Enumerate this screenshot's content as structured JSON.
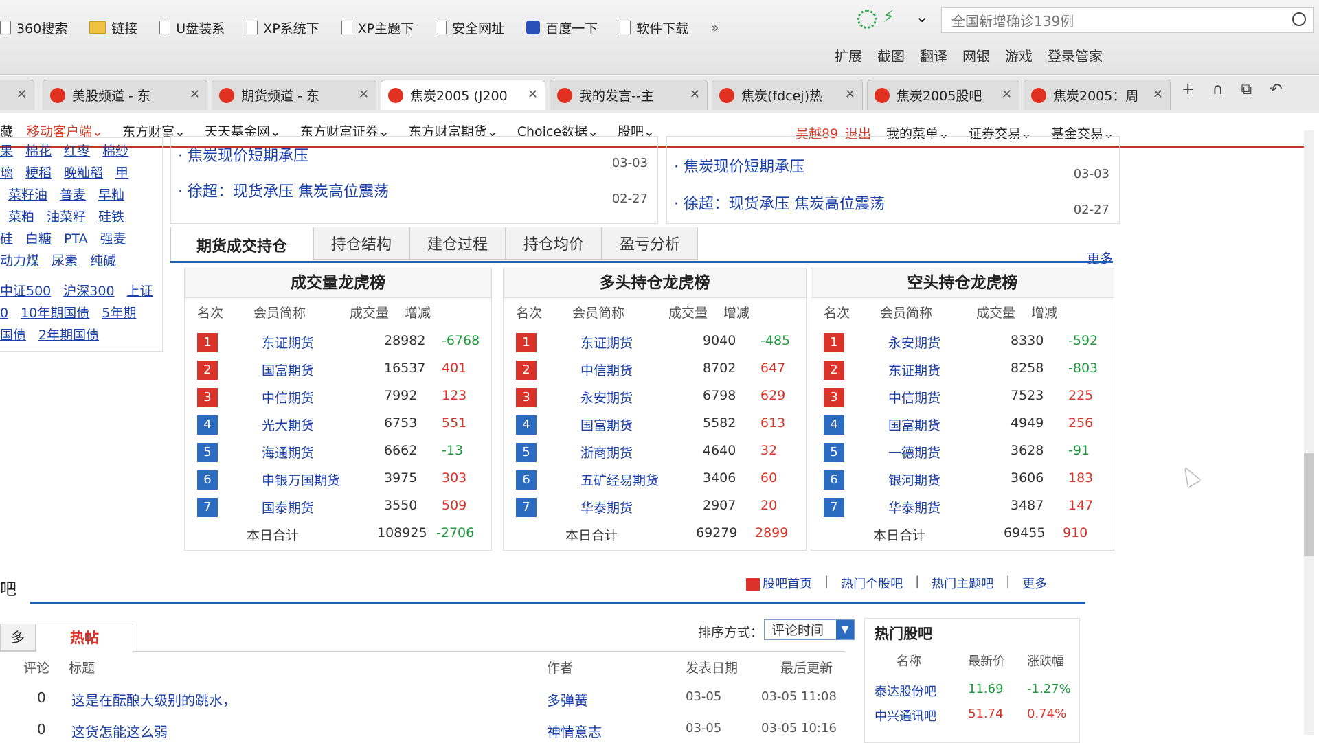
{
  "bookmarks": [
    {
      "label": "360搜索",
      "icon": "page-icon"
    },
    {
      "label": "链接",
      "icon": "folder-icon"
    },
    {
      "label": "U盘装系",
      "icon": "page-icon"
    },
    {
      "label": "XP系统下",
      "icon": "page-icon"
    },
    {
      "label": "XP主题下",
      "icon": "page-icon"
    },
    {
      "label": "安全网址",
      "icon": "page-icon"
    },
    {
      "label": "百度一下",
      "icon": "baidu-paw-icon"
    },
    {
      "label": "软件下载",
      "icon": "page-icon"
    }
  ],
  "bookmark_more": "»",
  "search": {
    "text": "全国新增确诊139例"
  },
  "tools": [
    "扩展",
    "截图",
    "翻译",
    "网银",
    "游戏",
    "登录管家"
  ],
  "tabs": [
    {
      "label": "美股频道 - 东",
      "active": false
    },
    {
      "label": "期货频道 - 东",
      "active": false
    },
    {
      "label": "焦炭2005 (J200",
      "active": true
    },
    {
      "label": "我的发言--主",
      "active": false
    },
    {
      "label": "焦炭(fdcej)热",
      "active": false
    },
    {
      "label": "焦炭2005股吧",
      "active": false
    },
    {
      "label": "焦炭2005：周",
      "active": false
    }
  ],
  "tab_controls": [
    "+",
    "∩",
    "⧉",
    "↶"
  ],
  "nav": {
    "first": "藏",
    "items": [
      "移动客户端",
      "东方财富",
      "天天基金网",
      "东方财富证券",
      "东方财富期货",
      "Choice数据",
      "股吧"
    ],
    "user": "吴越89",
    "logout": "退出",
    "right": [
      "我的菜单",
      "证券交易",
      "基金交易"
    ]
  },
  "sidebar": [
    [
      "果",
      "棉花",
      "红枣",
      "棉纱"
    ],
    [
      "璃",
      "粳稻",
      "晚籼稻",
      "甲"
    ],
    [
      "",
      "菜籽油",
      "普麦",
      "早籼"
    ],
    [
      "",
      "菜粕",
      "油菜籽",
      "硅铁"
    ],
    [
      "硅",
      "白糖",
      "PTA",
      "强麦"
    ],
    [
      "动力煤",
      "尿素",
      "纯碱"
    ],
    [],
    [
      "中证500",
      "沪深300",
      "上证"
    ],
    [
      "0",
      "10年期国债",
      "5年期"
    ],
    [
      "国债",
      "2年期国债"
    ]
  ],
  "news_left": [
    {
      "title": "焦炭现价短期承压",
      "date": "03-03"
    },
    {
      "title": "徐超：现货承压 焦炭高位震荡",
      "date": "02-27"
    }
  ],
  "news_right": [
    {
      "title": "焦炭现价短期承压",
      "date": "03-03"
    },
    {
      "title": "徐超：现货承压 焦炭高位震荡",
      "date": "02-27"
    }
  ],
  "main_tabs": [
    "期货成交持仓",
    "持仓结构",
    "建仓过程",
    "持仓均价",
    "盈亏分析"
  ],
  "more": "更多",
  "panels": [
    {
      "title": "成交量龙虎榜",
      "headers": [
        "名次",
        "会员简称",
        "成交量",
        "增减"
      ],
      "rows": [
        {
          "rank": "1",
          "name": "东证期货",
          "vol": "28982",
          "chg": "-6768"
        },
        {
          "rank": "2",
          "name": "国富期货",
          "vol": "16537",
          "chg": "401"
        },
        {
          "rank": "3",
          "name": "中信期货",
          "vol": "7992",
          "chg": "123"
        },
        {
          "rank": "4",
          "name": "光大期货",
          "vol": "6753",
          "chg": "551"
        },
        {
          "rank": "5",
          "name": "海通期货",
          "vol": "6662",
          "chg": "-13"
        },
        {
          "rank": "6",
          "name": "申银万国期货",
          "vol": "3975",
          "chg": "303"
        },
        {
          "rank": "7",
          "name": "国泰期货",
          "vol": "3550",
          "chg": "509"
        }
      ],
      "total": {
        "label": "本日合计",
        "vol": "108925",
        "chg": "-2706"
      }
    },
    {
      "title": "多头持仓龙虎榜",
      "headers": [
        "名次",
        "会员简称",
        "成交量",
        "增减"
      ],
      "rows": [
        {
          "rank": "1",
          "name": "东证期货",
          "vol": "9040",
          "chg": "-485"
        },
        {
          "rank": "2",
          "name": "中信期货",
          "vol": "8702",
          "chg": "647"
        },
        {
          "rank": "3",
          "name": "永安期货",
          "vol": "6798",
          "chg": "629"
        },
        {
          "rank": "4",
          "name": "国富期货",
          "vol": "5582",
          "chg": "613"
        },
        {
          "rank": "5",
          "name": "浙商期货",
          "vol": "4640",
          "chg": "32"
        },
        {
          "rank": "6",
          "name": "五矿经易期货",
          "vol": "3406",
          "chg": "60"
        },
        {
          "rank": "7",
          "name": "华泰期货",
          "vol": "2907",
          "chg": "20"
        }
      ],
      "total": {
        "label": "本日合计",
        "vol": "69279",
        "chg": "2899"
      }
    },
    {
      "title": "空头持仓龙虎榜",
      "headers": [
        "名次",
        "会员简称",
        "成交量",
        "增减"
      ],
      "rows": [
        {
          "rank": "1",
          "name": "永安期货",
          "vol": "8330",
          "chg": "-592"
        },
        {
          "rank": "2",
          "name": "东证期货",
          "vol": "8258",
          "chg": "-803"
        },
        {
          "rank": "3",
          "name": "中信期货",
          "vol": "7523",
          "chg": "225"
        },
        {
          "rank": "4",
          "name": "国富期货",
          "vol": "4949",
          "chg": "256"
        },
        {
          "rank": "5",
          "name": "一德期货",
          "vol": "3628",
          "chg": "-91"
        },
        {
          "rank": "6",
          "name": "银河期货",
          "vol": "3606",
          "chg": "183"
        },
        {
          "rank": "7",
          "name": "华泰期货",
          "vol": "3487",
          "chg": "147"
        }
      ],
      "total": {
        "label": "本日合计",
        "vol": "69455",
        "chg": "910"
      }
    }
  ],
  "bar_links": [
    "股吧首页",
    "热门个股吧",
    "热门主题吧",
    "更多"
  ],
  "ba_label": "吧",
  "bottom_tabs": {
    "left": "多",
    "active": "热帖"
  },
  "sort": {
    "label": "排序方式：",
    "value": "评论时间"
  },
  "post_headers": {
    "comments": "评论",
    "title": "标题",
    "author": "作者",
    "date": "发表日期",
    "updated": "最后更新"
  },
  "posts": [
    {
      "comments": "0",
      "title": "这是在酝酿大级别的跳水，",
      "author": "多弹簧",
      "date": "03-05",
      "updated": "03-05 11:08"
    },
    {
      "comments": "0",
      "title": "这货怎能这么弱",
      "author": "神情意志",
      "date": "03-05",
      "updated": "03-05 10:16"
    }
  ],
  "hot_bars": {
    "title": "热门股吧",
    "headers": [
      "名称",
      "最新价",
      "涨跌幅"
    ],
    "rows": [
      {
        "name": "泰达股份吧",
        "price": "11.69",
        "chg": "-1.27%"
      },
      {
        "name": "中兴通讯吧",
        "price": "51.74",
        "chg": "0.74%"
      }
    ]
  }
}
